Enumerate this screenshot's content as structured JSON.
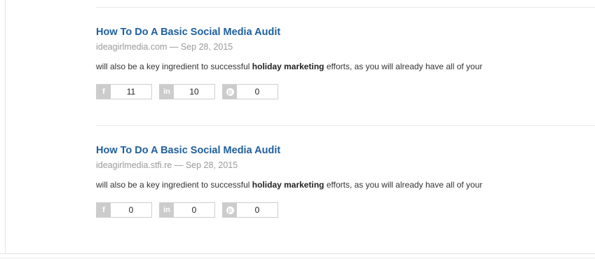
{
  "articles": [
    {
      "title": "How To Do A Basic Social Media Audit",
      "meta": "ideagirlmedia.com — Sep 28, 2015",
      "snippet_before": "will also be a key ingredient to successful ",
      "snippet_bold": "holiday marketing",
      "snippet_after": " efforts, as you will already have all of your",
      "shares": {
        "facebook": "11",
        "linkedin": "10",
        "pinterest": "0"
      }
    },
    {
      "title": "How To Do A Basic Social Media Audit",
      "meta": "ideagirlmedia.stfi.re — Sep 28, 2015",
      "snippet_before": "will also be a key ingredient to successful ",
      "snippet_bold": "holiday marketing",
      "snippet_after": " efforts, as you will already have all of your",
      "shares": {
        "facebook": "0",
        "linkedin": "0",
        "pinterest": "0"
      }
    }
  ],
  "icons": {
    "facebook": "facebook-icon",
    "linkedin": "linkedin-icon",
    "pinterest": "pinterest-icon"
  },
  "colors": {
    "title": "#1e5f9c",
    "meta": "#9a9a9a",
    "icon_bg": "#cccccc"
  }
}
